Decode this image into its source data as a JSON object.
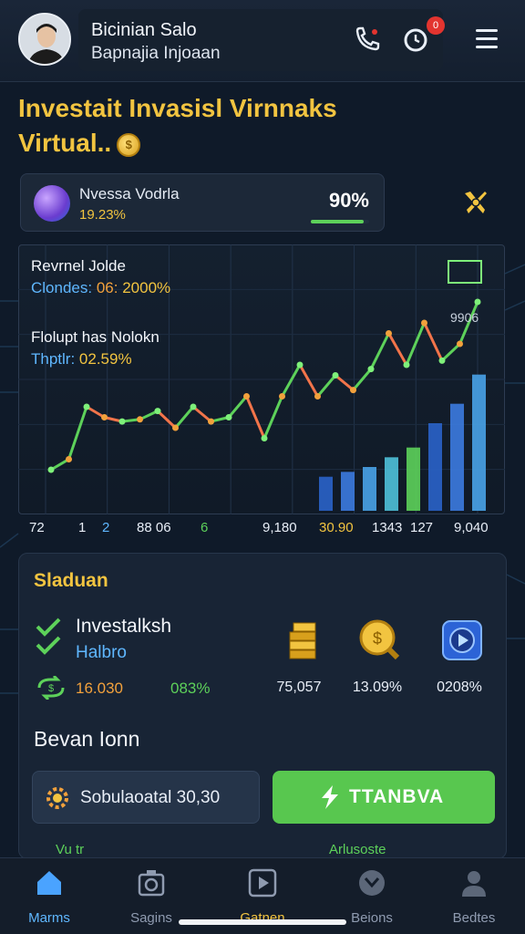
{
  "header": {
    "user_name": "Bicinian Salo",
    "user_subtitle": "Bapnajia Injoaan",
    "notification_badge": "0"
  },
  "title": {
    "line1": "Investait Invasisl Virnnaks",
    "line2": "Virtual.."
  },
  "stat_card": {
    "label": "Nvessa Vodrla",
    "change": "19.23%",
    "value": "90%",
    "progress": 0.9
  },
  "chart_overlay": {
    "label1": "Revrnel Jolde",
    "label2_key": "Clondes:",
    "label2_val1": "06:",
    "label2_val2": "2000%",
    "label3": "Flolupt has Nolokn",
    "label4_key": "Thptlr:",
    "label4_val": "02.59%",
    "peak_label": "9906"
  },
  "chart_data": {
    "type": "line",
    "x": [
      "72",
      "1",
      "2",
      "88 06",
      "6",
      "9,180",
      "30.90",
      "1343",
      "127",
      "9,040"
    ],
    "series": [
      {
        "values": [
          10,
          15,
          40,
          35,
          33,
          34,
          38,
          30,
          40,
          33,
          35,
          45,
          25,
          45,
          60,
          45,
          55,
          48,
          58,
          75,
          60,
          80,
          62,
          70,
          90
        ]
      },
      {
        "values": [
          1,
          1,
          2,
          4,
          6,
          7,
          8,
          9,
          11,
          13,
          18,
          22,
          28
        ]
      }
    ]
  },
  "summary": {
    "title": "Sladuan",
    "inv_title": "Investalksh",
    "inv_sub": "Halbro",
    "inv_amount": "16.030",
    "inv_pct": "083%",
    "asset1_val": "75,057",
    "asset2_val": "13.09%",
    "asset3_val": "0208%",
    "section_title": "Bevan Ionn",
    "action_left": "Sobulaoatal 30,30",
    "action_right": "TTANBVA",
    "peek_left": "Vu tr",
    "peek_right": "Arlusoste"
  },
  "nav": {
    "items": [
      "Marms",
      "Sagins",
      "Gatnen",
      "Beions",
      "Bedtes"
    ]
  },
  "colors": {
    "accent_yellow": "#f2c440",
    "accent_green": "#5dd15a",
    "accent_blue": "#5fb7ff",
    "accent_red": "#e3342f"
  }
}
